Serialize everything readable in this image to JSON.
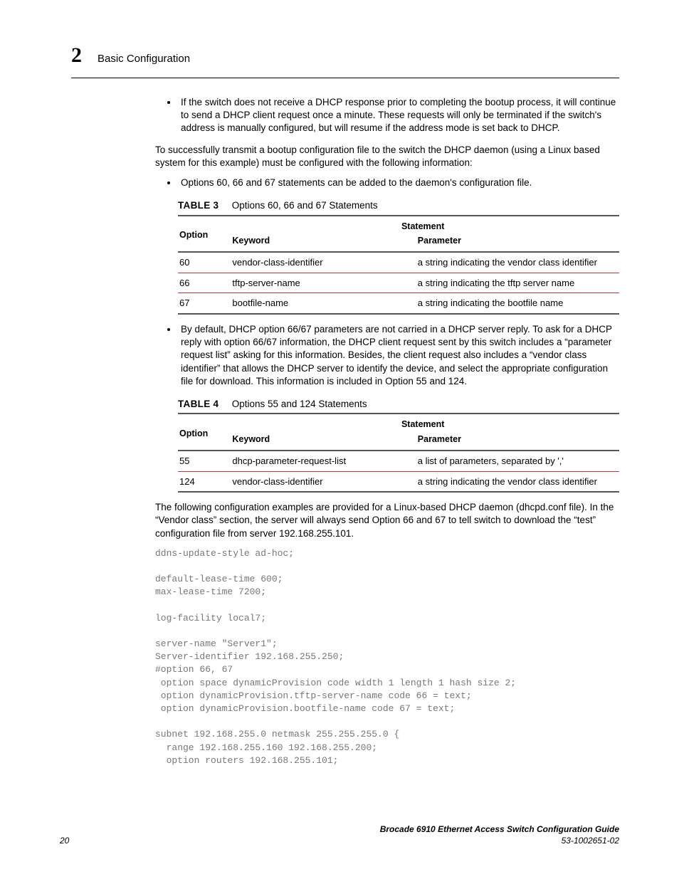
{
  "header": {
    "chapter_number": "2",
    "chapter_title": "Basic Configuration"
  },
  "body": {
    "bullets1": [
      "If the switch does not receive a DHCP response prior to completing the bootup process, it will continue to send a DHCP client request once a minute. These requests will only be terminated if the switch's address is manually configured, but will resume if the address mode is set back to DHCP."
    ],
    "para1": "To successfully transmit a bootup configuration file to the switch the DHCP daemon (using a Linux based system for this example) must be configured with the following information:",
    "bullets2": [
      "Options 60, 66 and 67 statements can be added to the daemon's configuration file."
    ],
    "table3": {
      "label": "TABLE 3",
      "caption": "Options 60, 66 and 67 Statements",
      "head_option": "Option",
      "head_statement": "Statement",
      "head_keyword": "Keyword",
      "head_parameter": "Parameter",
      "rows": [
        {
          "opt": "60",
          "kw": "vendor-class-identifier",
          "param": "a string indicating the vendor class identifier"
        },
        {
          "opt": "66",
          "kw": "tftp-server-name",
          "param": "a string indicating the tftp server name"
        },
        {
          "opt": "67",
          "kw": "bootfile-name",
          "param": "a string indicating the bootfile name"
        }
      ]
    },
    "bullets3": [
      "By default, DHCP option 66/67 parameters are not carried in a DHCP server reply. To ask for a DHCP reply with option 66/67 information, the DHCP client request sent by this switch includes a “parameter request list” asking for this information. Besides, the client request also includes a “vendor class identifier” that allows the DHCP server to identify the device, and select the appropriate configuration file for download. This information is included in Option 55 and 124."
    ],
    "table4": {
      "label": "TABLE 4",
      "caption": "Options 55 and 124 Statements",
      "head_option": "Option",
      "head_statement": "Statement",
      "head_keyword": "Keyword",
      "head_parameter": "Parameter",
      "rows": [
        {
          "opt": "55",
          "kw": "dhcp-parameter-request-list",
          "param": "a list of parameters, separated by ','"
        },
        {
          "opt": "124",
          "kw": "vendor-class-identifier",
          "param": "a string indicating the vendor class identifier"
        }
      ]
    },
    "para2": "The following configuration examples are provided for a Linux-based DHCP daemon (dhcpd.conf file). In the “Vendor class” section, the server will always send Option 66 and 67 to tell switch to download the “test” configuration file from server 192.168.255.101.",
    "code": "ddns-update-style ad-hoc;\n\ndefault-lease-time 600;\nmax-lease-time 7200;\n\nlog-facility local7;\n\nserver-name \"Server1\";\nServer-identifier 192.168.255.250;\n#option 66, 67\n option space dynamicProvision code width 1 length 1 hash size 2;\n option dynamicProvision.tftp-server-name code 66 = text;\n option dynamicProvision.bootfile-name code 67 = text;\n\nsubnet 192.168.255.0 netmask 255.255.255.0 {\n  range 192.168.255.160 192.168.255.200;\n  option routers 192.168.255.101;"
  },
  "footer": {
    "page_number": "20",
    "book_title": "Brocade 6910 Ethernet Access Switch Configuration Guide",
    "doc_number": "53-1002651-02"
  }
}
